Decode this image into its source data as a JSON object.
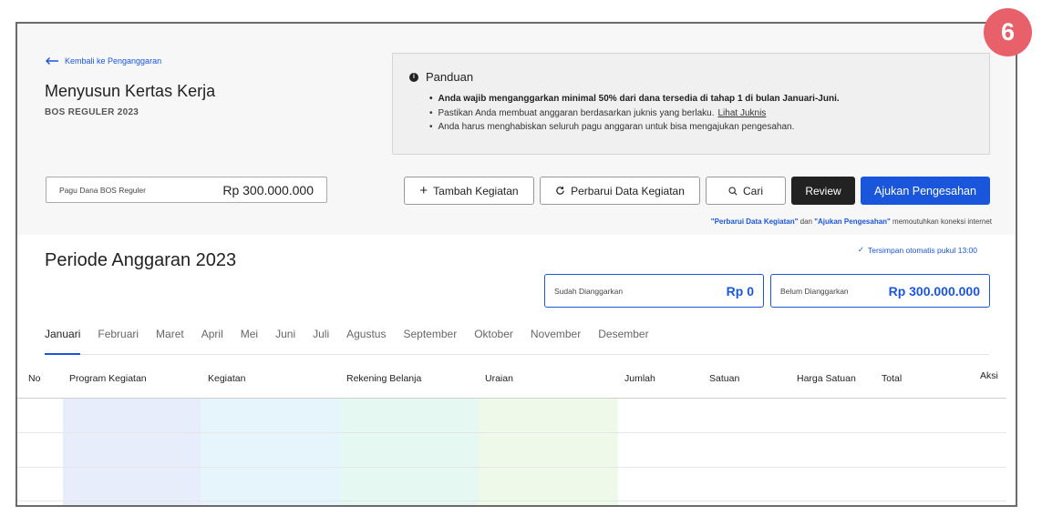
{
  "header": {
    "back_label": "Kembali ke Penganggaran",
    "title": "Menyusun Kertas Kerja",
    "subtitle": "BOS REGULER 2023"
  },
  "guide": {
    "title": "Panduan",
    "items": [
      "Anda wajib menganggarkan minimal 50% dari dana tersedia di tahap 1 di bulan Januari-Juni.",
      "Pastikan Anda membuat anggaran berdasarkan juknis yang berlaku.",
      "Anda harus menghabiskan seluruh pagu anggaran untuk bisa mengajukan pengesahan."
    ],
    "link": "Lihat Juknis"
  },
  "pagu": {
    "label": "Pagu Dana BOS Reguler",
    "value": "Rp 300.000.000"
  },
  "toolbar": {
    "add": "Tambah Kegiatan",
    "refresh": "Perbarui Data Kegiatan",
    "search": "Cari",
    "review": "Review",
    "submit": "Ajukan Pengesahan"
  },
  "note": {
    "q1": "\"Perbarui Data Kegiatan\"",
    "and": " dan ",
    "q2": "\"Ajukan Pengesahan\"",
    "rest": " memoutuhkan koneksi internet"
  },
  "saved": "Tersimpan otomatis pukul 13:00",
  "period_title": "Periode Anggaran 2023",
  "summary": {
    "budgeted_label": "Sudah Dianggarkan",
    "budgeted_value": "Rp 0",
    "remaining_label": "Belum Dianggarkan",
    "remaining_value": "Rp 300.000.000"
  },
  "months": [
    "Januari",
    "Februari",
    "Maret",
    "April",
    "Mei",
    "Juni",
    "Juli",
    "Agustus",
    "September",
    "Oktober",
    "November",
    "Desember"
  ],
  "table": {
    "columns": [
      "No",
      "Program Kegiatan",
      "Kegiatan",
      "Rekening Belanja",
      "Uraian",
      "Jumlah",
      "Satuan",
      "Harga Satuan",
      "Total",
      "Aksi"
    ]
  },
  "colors": {
    "accent": "#1a56db",
    "badge": "#e8616a",
    "col_program": "#e8edfb",
    "col_kegiatan": "#e6f4fb",
    "col_rekening": "#e6f8f2",
    "col_uraian": "#eef9e9"
  },
  "badge": "6"
}
